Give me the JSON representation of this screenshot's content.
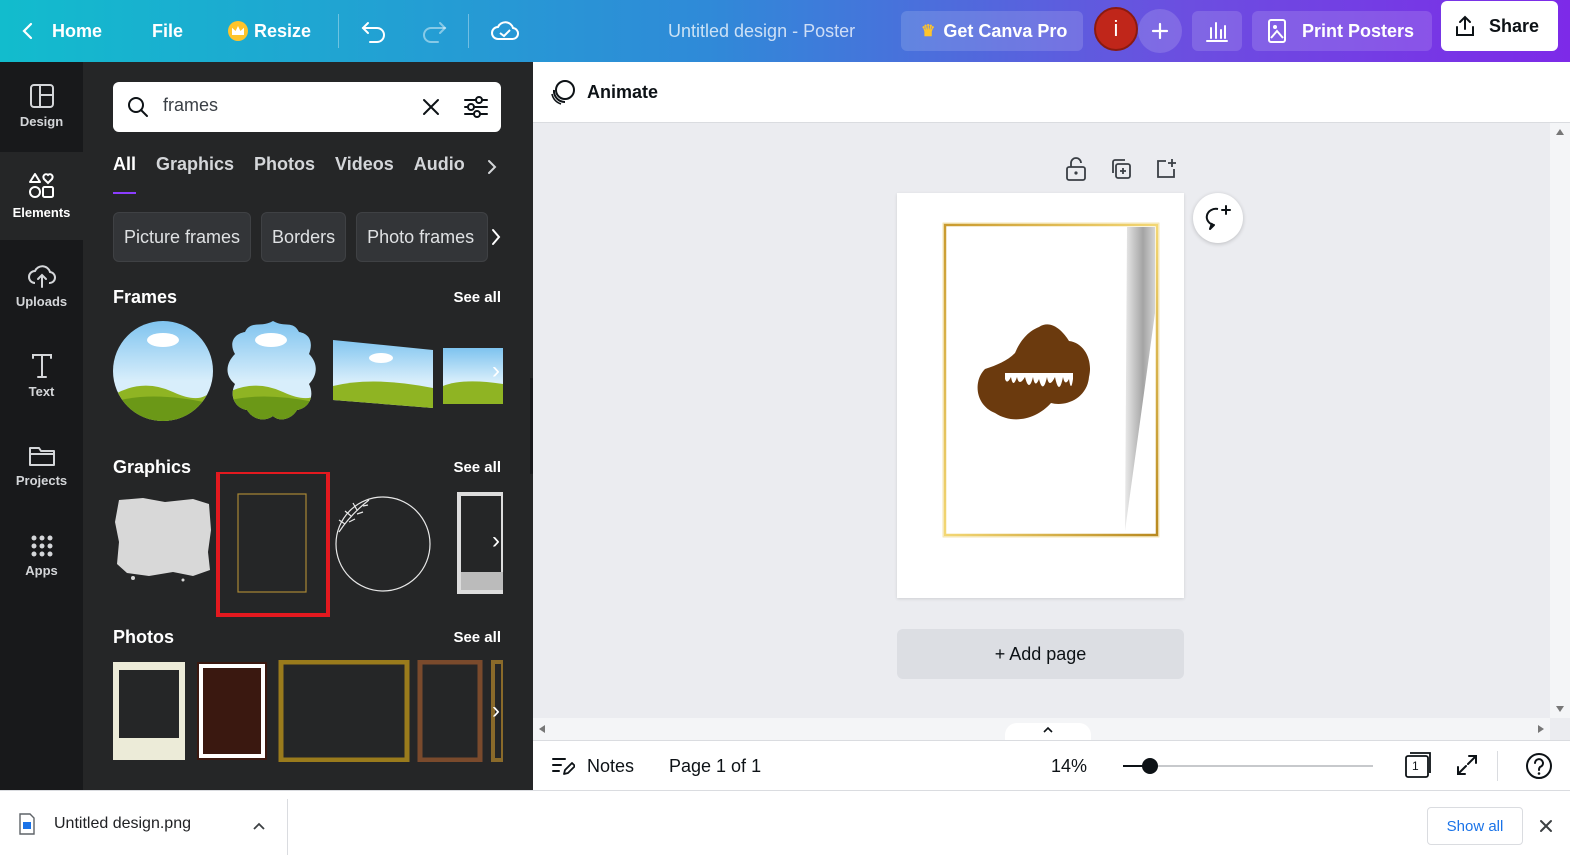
{
  "topbar": {
    "home": "Home",
    "file": "File",
    "resize": "Resize",
    "doc_title": "Untitled design - Poster",
    "get_pro": "Get Canva Pro",
    "avatar_initial": "i",
    "print": "Print Posters",
    "share": "Share"
  },
  "rail": {
    "items": [
      {
        "label": "Design",
        "icon": "layout-icon"
      },
      {
        "label": "Elements",
        "icon": "shapes-icon"
      },
      {
        "label": "Uploads",
        "icon": "cloud-upload-icon"
      },
      {
        "label": "Text",
        "icon": "text-icon"
      },
      {
        "label": "Projects",
        "icon": "folder-icon"
      },
      {
        "label": "Apps",
        "icon": "grid-icon"
      }
    ]
  },
  "panel": {
    "search_value": "frames",
    "tabs": [
      "All",
      "Graphics",
      "Photos",
      "Videos",
      "Audio"
    ],
    "chips": [
      "Picture frames",
      "Borders",
      "Photo frames"
    ],
    "frames_title": "Frames",
    "graphics_title": "Graphics",
    "photos_title": "Photos",
    "see_all": "See all"
  },
  "editor": {
    "animate": "Animate",
    "add_page": "+ Add page",
    "notes": "Notes",
    "page_info": "Page 1 of 1",
    "zoom": "14%",
    "zoom_fraction": 0.02,
    "page_count_badge": "1"
  },
  "download": {
    "file_name": "Untitled design.png",
    "show_all": "Show all"
  },
  "colors": {
    "accent": "#8b3dff",
    "highlight": "#e3191f",
    "blob": "#6b3a0e",
    "gold": "#d4a93a"
  }
}
